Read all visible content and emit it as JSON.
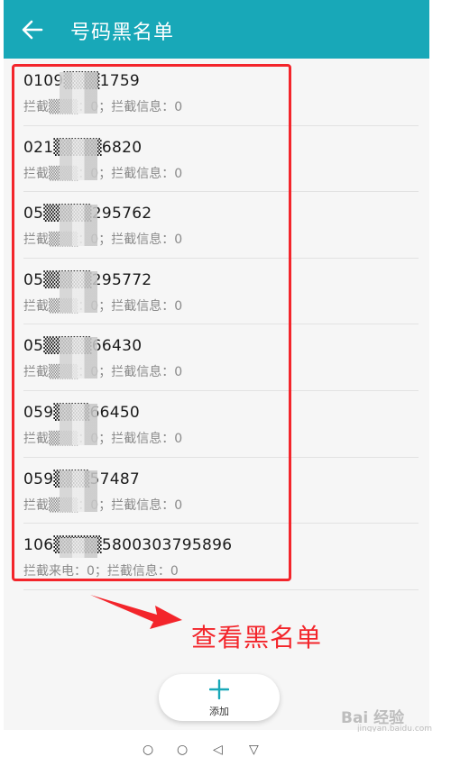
{
  "appbar": {
    "title": "号码黑名单",
    "back_icon": "arrow-left-icon"
  },
  "blacklist": {
    "items": [
      {
        "number": "0109▒▒▒1759",
        "stats": "拦截▒▒▒：0；拦截信息：0"
      },
      {
        "number": "021▒▒▒▒6820",
        "stats": "拦截▒▒▒：0；拦截信息：0"
      },
      {
        "number": "05▒▒▒▒295762",
        "stats": "拦截▒▒▒：0；拦截信息：0"
      },
      {
        "number": "05▒▒▒▒295772",
        "stats": "拦截▒▒▒：0；拦截信息：0"
      },
      {
        "number": "05▒▒▒▒66430",
        "stats": "拦截▒▒▒：0；拦截信息：0"
      },
      {
        "number": "059▒▒▒66450",
        "stats": "拦截▒▒▒：0；拦截信息：0"
      },
      {
        "number": "059▒▒▒57487",
        "stats": "拦截▒▒▒：0；拦截信息：0"
      },
      {
        "number": "106▒▒▒▒5800303795896",
        "stats": "拦截来电：0；拦截信息：0"
      }
    ]
  },
  "annotation": {
    "text": "查看黑名单",
    "color": "#f3252b"
  },
  "add_button": {
    "label": "添加",
    "icon": "plus-icon"
  },
  "watermark": {
    "text": "Bai 经验",
    "sub": "jingyan.baidu.com"
  },
  "colors": {
    "appbar": "#18a8b8",
    "accent": "#18a8b8",
    "highlight": "#f3252b"
  }
}
